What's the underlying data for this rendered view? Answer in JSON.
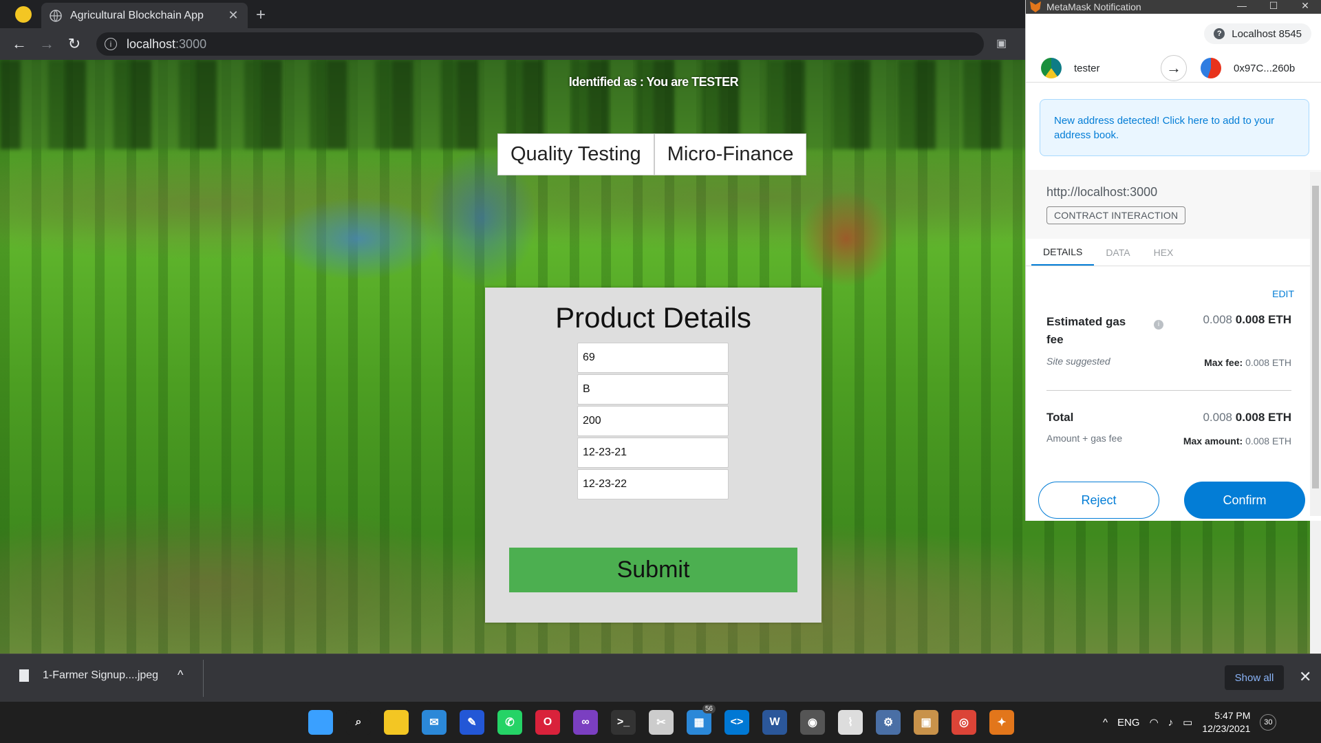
{
  "browser": {
    "tab_title": "Agricultural Blockchain App",
    "tab_close": "✕",
    "new_tab": "+",
    "url_host": "localhost",
    "url_port": ":3000",
    "nav_back": "←",
    "nav_forward": "→",
    "nav_reload": "↻"
  },
  "page": {
    "identified_text": "Identified as : You are TESTER",
    "nav_tabs": [
      "Quality Testing",
      "Micro-Finance"
    ],
    "card_title": "Product Details",
    "fields": [
      "69",
      "B",
      "200",
      "12-23-21",
      "12-23-22"
    ],
    "submit_label": "Submit"
  },
  "downloads": {
    "file_name": "1-Farmer Signup....jpeg",
    "show_all": "Show all",
    "close": "✕",
    "chevron": "^"
  },
  "taskbar": {
    "icons": [
      {
        "name": "windows-start-icon",
        "glyph": "",
        "color": "#3aa0ff"
      },
      {
        "name": "search-icon",
        "glyph": "⌕",
        "color": "#1f1f1f"
      },
      {
        "name": "file-explorer-icon",
        "glyph": "",
        "color": "#f3c623"
      },
      {
        "name": "mail-icon",
        "glyph": "✉",
        "color": "#2b88d8"
      },
      {
        "name": "pen-app-icon",
        "glyph": "✎",
        "color": "#2357d6"
      },
      {
        "name": "whatsapp-icon",
        "glyph": "✆",
        "color": "#25d366"
      },
      {
        "name": "opera-icon",
        "glyph": "O",
        "color": "#d9223b"
      },
      {
        "name": "visual-studio-icon",
        "glyph": "∞",
        "color": "#7b3fc1"
      },
      {
        "name": "terminal-icon",
        "glyph": ">_",
        "color": "#333333"
      },
      {
        "name": "snipping-tool-icon",
        "glyph": "✂",
        "color": "#cccccc"
      },
      {
        "name": "news-icon",
        "glyph": "▦",
        "color": "#2b88d8",
        "badge": "56"
      },
      {
        "name": "vscode-icon",
        "glyph": "<>",
        "color": "#0078d4"
      },
      {
        "name": "word-icon",
        "glyph": "W",
        "color": "#2b579a"
      },
      {
        "name": "github-icon",
        "glyph": "◉",
        "color": "#555555"
      },
      {
        "name": "monitor-icon",
        "glyph": "⌇",
        "color": "#dddddd"
      },
      {
        "name": "settings-gear-icon",
        "glyph": "⚙",
        "color": "#4a6fa5"
      },
      {
        "name": "box-app-icon",
        "glyph": "▣",
        "color": "#c8924a"
      },
      {
        "name": "chrome-icon",
        "glyph": "◎",
        "color": "#db4437"
      },
      {
        "name": "metamask-icon",
        "glyph": "✦",
        "color": "#e2761b"
      }
    ],
    "tray_chevron": "^",
    "language": "ENG",
    "time": "5:47 PM",
    "date": "12/23/2021",
    "notifications": "30"
  },
  "metamask": {
    "window_title": "MetaMask Notification",
    "network": "Localhost 8545",
    "from_account": "tester",
    "to_account": "0x97C...260b",
    "alert": "New address detected! Click here to add to your address book.",
    "origin": "http://localhost:3000",
    "interaction_type": "CONTRACT INTERACTION",
    "tabs": [
      "DETAILS",
      "DATA",
      "HEX"
    ],
    "edit": "EDIT",
    "gas_label": "Estimated gas fee",
    "gas_value_muted": "0.008",
    "gas_value": "0.008 ETH",
    "site_suggested": "Site suggested",
    "max_fee_label": "Max fee:",
    "max_fee_value": "0.008 ETH",
    "total_label": "Total",
    "total_value_muted": "0.008",
    "total_value": "0.008 ETH",
    "amount_gas": "Amount + gas fee",
    "max_amount_label": "Max amount:",
    "max_amount_value": "0.008 ETH",
    "reject": "Reject",
    "confirm": "Confirm"
  }
}
